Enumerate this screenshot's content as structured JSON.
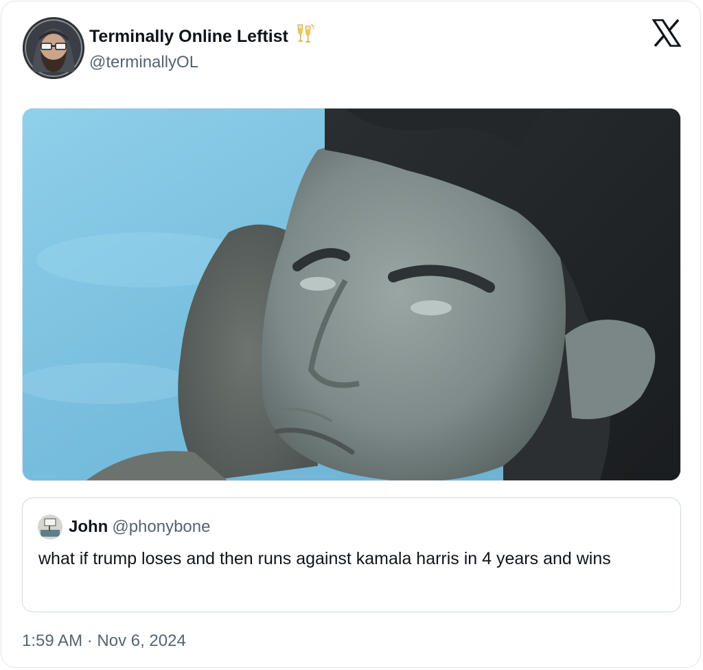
{
  "author": {
    "display_name": "Terminally Online Leftist",
    "handle": "@terminallyOL",
    "name_emoji": "clinking-glasses-icon"
  },
  "brand": {
    "logo": "x-logo-icon"
  },
  "media": {
    "description_icon": "photo"
  },
  "quoted_post": {
    "author_name": "John",
    "author_handle": "@phonybone",
    "text": "what if trump loses and then runs against kamala harris in 4 years and wins"
  },
  "timestamp": "1:59 AM · Nov 6, 2024",
  "colors": {
    "text_primary": "#0f1419",
    "text_secondary": "#536471",
    "border": "#cfd9de"
  }
}
